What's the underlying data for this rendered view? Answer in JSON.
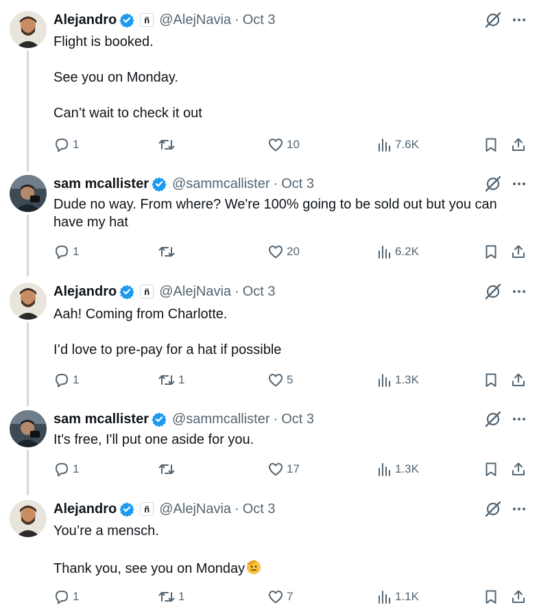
{
  "tweets": [
    {
      "name": "Alejandro",
      "handle": "@AlejNavia",
      "date": "Oct 3",
      "affiliate": true,
      "avatar": "alejandro-avatar",
      "text": "Flight is booked.\n\nSee you on Monday.\n\nCan’t wait to check it out",
      "replies": "1",
      "retweets": "",
      "likes": "10",
      "views": "7.6K"
    },
    {
      "name": "sam mcallister",
      "handle": "@sammcallister",
      "date": "Oct 3",
      "affiliate": false,
      "avatar": "sam-avatar",
      "text": "Dude no way. From where? We're 100% going to be sold out but you can\nhave my hat",
      "replies": "1",
      "retweets": "",
      "likes": "20",
      "views": "6.2K"
    },
    {
      "name": "Alejandro",
      "handle": "@AlejNavia",
      "date": "Oct 3",
      "affiliate": true,
      "avatar": "alejandro-avatar",
      "text": "Aah! Coming from Charlotte.\n\nI’d love to pre-pay for a hat if possible",
      "replies": "1",
      "retweets": "1",
      "likes": "5",
      "views": "1.3K"
    },
    {
      "name": "sam mcallister",
      "handle": "@sammcallister",
      "date": "Oct 3",
      "affiliate": false,
      "avatar": "sam-avatar",
      "text": "It's free, I'll put one aside for you.",
      "replies": "1",
      "retweets": "",
      "likes": "17",
      "views": "1.3K"
    },
    {
      "name": "Alejandro",
      "handle": "@AlejNavia",
      "date": "Oct 3",
      "affiliate": true,
      "avatar": "alejandro-avatar",
      "text": "You’re a mensch.\n\nThank you, see you on Monday",
      "emoji": "saluting-face-emoji",
      "replies": "1",
      "retweets": "1",
      "likes": "7",
      "views": "1.1K"
    }
  ],
  "separator": "·",
  "affiliate_badge": "ñ",
  "colors": {
    "verified": "#1d9bf0",
    "muted": "#536471",
    "text": "#0f1419",
    "thread_line": "#cfd9de"
  }
}
